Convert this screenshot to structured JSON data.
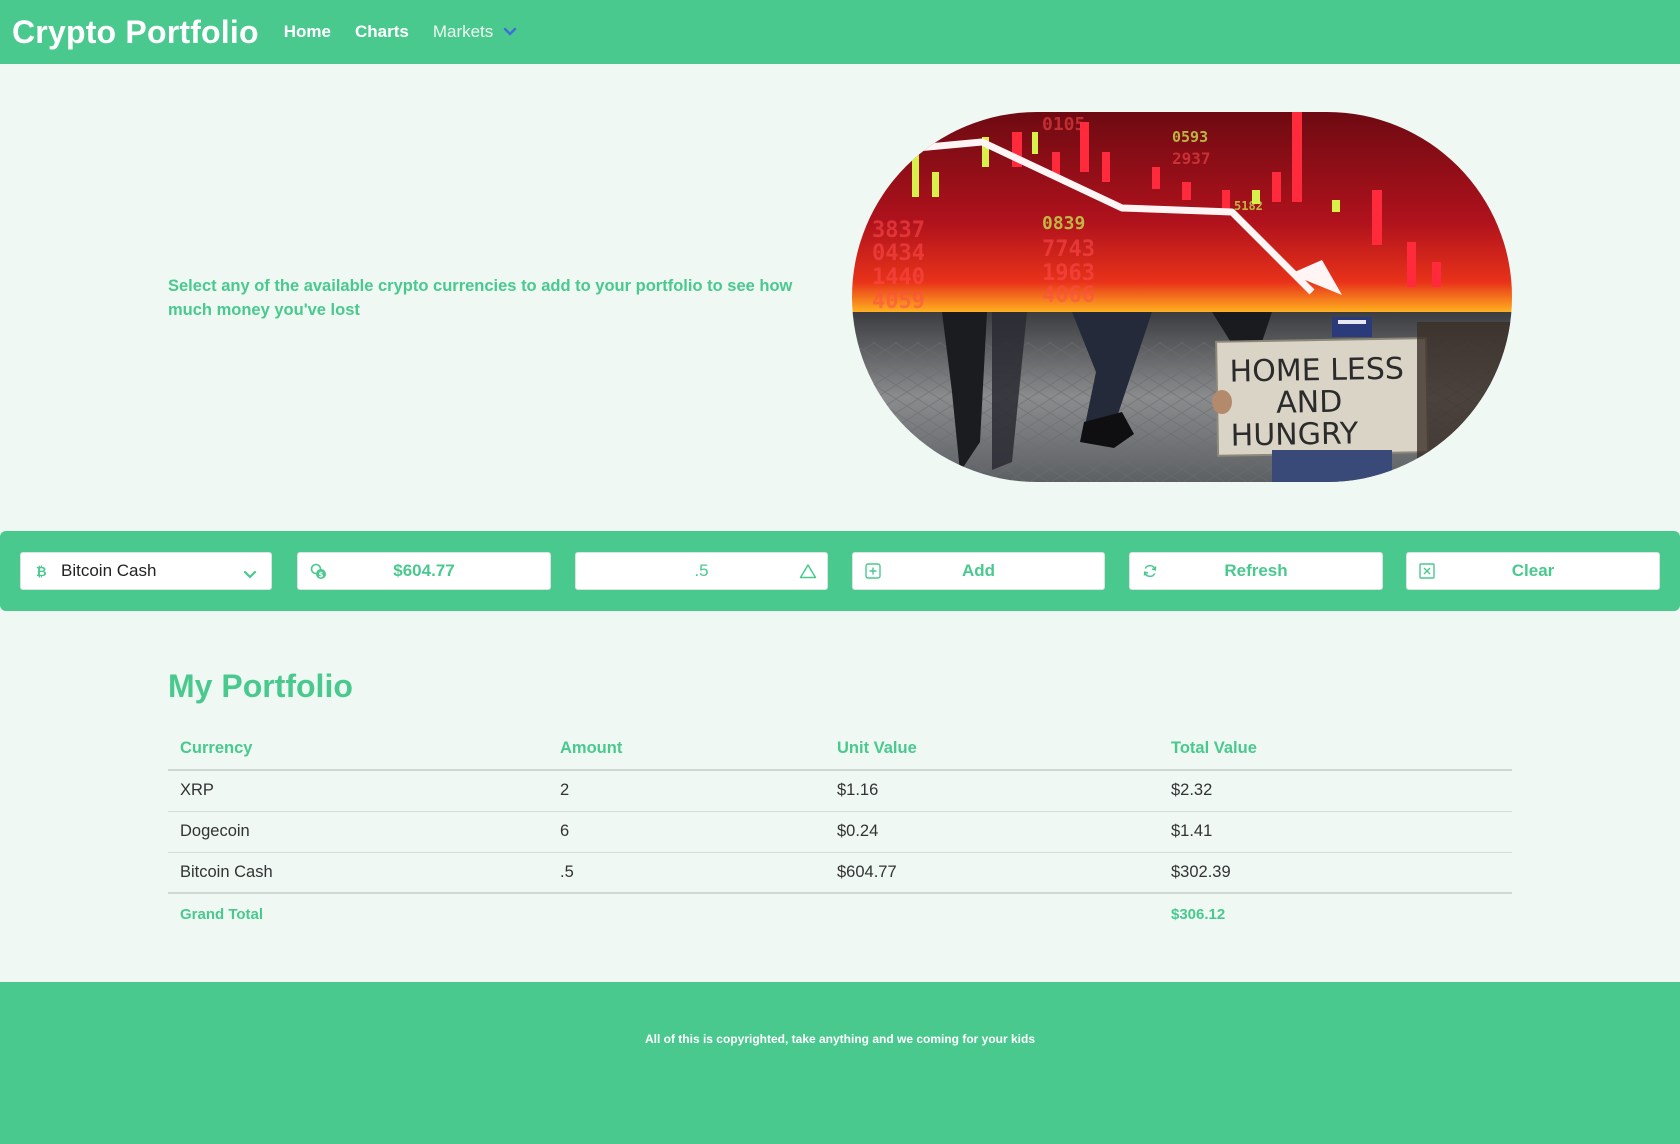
{
  "navbar": {
    "brand": "Crypto Portfolio",
    "links": [
      "Home",
      "Charts"
    ],
    "markets_label": "Markets"
  },
  "hero": {
    "text": "Select any of the available crypto currencies to add to your portfolio to see how much money you've lost",
    "image": {
      "description_icon": "market-crash-homeless-image",
      "sign_lines": [
        "HOME LESS",
        "AND",
        "HUNGRY"
      ],
      "screen_numbers": [
        "3837",
        "0434",
        "1440",
        "4059",
        "0839",
        "7743",
        "1963",
        "4066",
        "0593",
        "2937",
        "0105",
        "5182"
      ]
    }
  },
  "controls": {
    "currency_select": {
      "value": "Bitcoin Cash",
      "icon": "bitcoin-icon"
    },
    "price": {
      "value": "$604.77",
      "icon": "coins-icon"
    },
    "amount": {
      "value": ".5",
      "icon": "warning-triangle-icon"
    },
    "add": {
      "label": "Add",
      "icon": "plus-square-icon"
    },
    "refresh": {
      "label": "Refresh",
      "icon": "refresh-icon"
    },
    "clear": {
      "label": "Clear",
      "icon": "x-square-icon"
    }
  },
  "portfolio": {
    "title": "My Portfolio",
    "headers": [
      "Currency",
      "Amount",
      "Unit Value",
      "Total Value"
    ],
    "rows": [
      [
        "XRP",
        "2",
        "$1.16",
        "$2.32"
      ],
      [
        "Dogecoin",
        "6",
        "$0.24",
        "$1.41"
      ],
      [
        "Bitcoin Cash",
        ".5",
        "$604.77",
        "$302.39"
      ]
    ],
    "grand_total_label": "Grand Total",
    "grand_total_value": "$306.12"
  },
  "footer": {
    "text": "All of this is copyrighted, take anything and we coming for your kids"
  },
  "colors": {
    "accent": "#4ac98f",
    "background": "#eff8f3",
    "markets_chevron": "#3f6fd8"
  }
}
